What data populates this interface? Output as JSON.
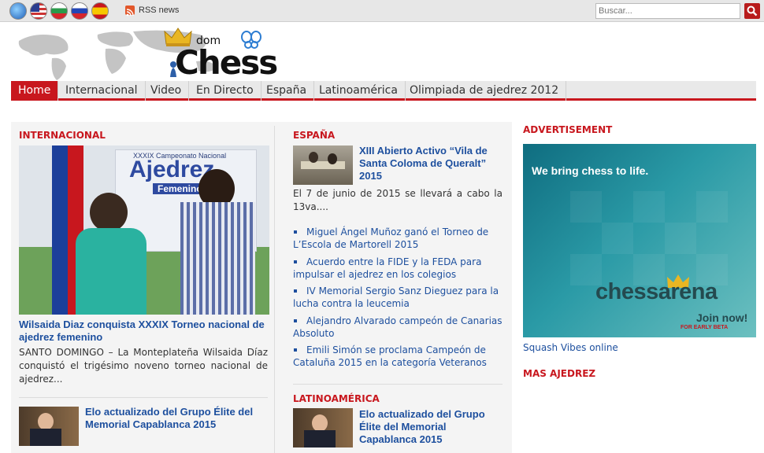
{
  "topbar": {
    "flags": [
      "globe-flag",
      "us-flag",
      "bulgaria-flag",
      "russia-flag",
      "spain-flag"
    ],
    "rss_label": "RSS news",
    "search_placeholder": "Buscar..."
  },
  "logo": {
    "small": "dom",
    "main": "Chess"
  },
  "nav": {
    "items": [
      "Home",
      "Internacional",
      "Video",
      "En Directo",
      "España",
      "Latinoamérica",
      "Olimpiada de ajedrez 2012"
    ]
  },
  "internacional": {
    "title": "INTERNACIONAL",
    "feature_headline": "Wilsaida Diaz conquista XXXIX Torneo nacional de ajedrez femenino",
    "feature_text": "SANTO DOMINGO – La Monteplateña Wilsaida Díaz conquistó el trigésimo noveno torneo nacional de ajedrez...",
    "banner_lines": [
      "XXXIX Campeonato Nacional",
      "Ajedrez",
      "Femenino 2"
    ],
    "second_headline": "Elo actualizado del Grupo Élite del Memorial Capablanca 2015"
  },
  "espana": {
    "title": "ESPAÑA",
    "lead_headline": "XIII Abierto Activo “Vila de Santa Coloma de Queralt” 2015",
    "lead_text": "El 7 de junio de 2015 se llevará a cabo la 13va....",
    "items": [
      "Miguel Ángel Muñoz ganó el Torneo de L’Escola de Martorell 2015",
      "Acuerdo entre la FIDE y la FEDA para impulsar el ajedrez en los colegios",
      "IV Memorial Sergio Sanz Dieguez para la lucha contra la leucemia",
      "Alejandro Alvarado campeón de Canarias Absoluto",
      "Emili Simón se proclama Campeón de Cataluña 2015 en la categoría Veteranos"
    ]
  },
  "latinoamerica": {
    "title": "LATINOAMÉRICA",
    "lead_headline": "Elo actualizado del Grupo Élite del Memorial Capablanca 2015"
  },
  "sidebar": {
    "ad_title": "ADVERTISEMENT",
    "ad_tagline": "We bring chess to life.",
    "ad_brand": "chessarena",
    "ad_cta": "Join now!",
    "ad_cta_small": "FOR EARLY BETA",
    "ad_link": "Squash Vibes online",
    "more_title": "MAS AJEDREZ"
  },
  "colors": {
    "accent": "#c8171e",
    "link": "#1d4f9e"
  }
}
